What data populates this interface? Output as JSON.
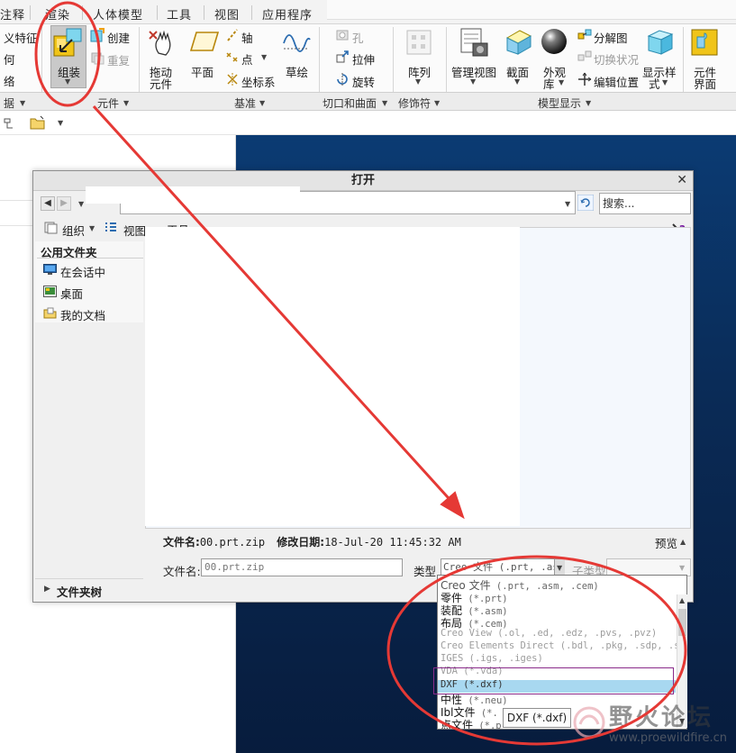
{
  "ribbon": {
    "tabs": [
      "注释",
      "渲染",
      "人体模型",
      "工具",
      "视图",
      "应用程序"
    ],
    "left_fragments": [
      "义特征",
      "何",
      "络"
    ],
    "assemble": "组装",
    "create": "创建",
    "repeat": "重复",
    "drag_component": [
      "拖动",
      "元件"
    ],
    "plane": "平面",
    "axis": "轴",
    "point": "点",
    "coord_sys": "坐标系",
    "sketch": "草绘",
    "hole": "孔",
    "extrude": "拉伸",
    "revolve": "旋转",
    "pattern": "阵列",
    "manage_views": "管理视图",
    "section": "截面",
    "appearance": [
      "外观",
      "库"
    ],
    "explode_view": "分解图",
    "toggle_state": "切换状况",
    "edit_position": "编辑位置",
    "display_style": [
      "显示样",
      "式"
    ],
    "component_interface": [
      "元件",
      "界面"
    ],
    "groups": {
      "data": "据",
      "component": "元件",
      "datum": "基准",
      "cut_surface": "切口和曲面",
      "modifier": "修饰符",
      "model_display": "模型显示"
    }
  },
  "dialog": {
    "title": "打开",
    "search_placeholder": "搜索...",
    "organize": "组织",
    "views": "视图",
    "tools": "工具",
    "public_folders": "公用文件夹",
    "folders": [
      "在会话中",
      "桌面",
      "我的文档"
    ],
    "folder_tree": "文件夹树",
    "info_label_name": "文件名:",
    "info_name": "00.prt.zip",
    "info_label_date": "修改日期:",
    "info_date": "18-Jul-20 11:45:32 AM",
    "preview": "预览",
    "filename_label": "文件名:",
    "filename_value": "00.prt.zip",
    "type_label": "类型",
    "type_value": "Creo 文件 (.prt, .as",
    "subtype_label": "子类型",
    "tooltip": "DXF (*.dxf)"
  },
  "type_options": [
    {
      "name": "Creo 文件",
      "ext": "(.prt, .asm, .cem)"
    },
    {
      "name": "零件",
      "ext": "(*.prt)"
    },
    {
      "name": "装配",
      "ext": "(*.asm)"
    },
    {
      "name": "布局",
      "ext": "(*.cem)"
    },
    {
      "name": "Creo View",
      "ext": "(.ol, .ed, .edz, .pvs, .pvz)"
    },
    {
      "name": "Creo Elements Direct",
      "ext": "(.bdl, .pkg, .sdp, .sd"
    },
    {
      "name": "IGES",
      "ext": "(.igs, .iges)"
    },
    {
      "name": "VDA",
      "ext": "(*.vda)"
    },
    {
      "name": "DXF",
      "ext": "(*.dxf)"
    },
    {
      "name": "中性",
      "ext": "(*.neu)"
    },
    {
      "name": "Ibl文件",
      "ext": "(*."
    },
    {
      "name": "点文件",
      "ext": "(*.p"
    }
  ],
  "watermark": {
    "text": "野火论坛",
    "url": "www.proewildfire.cn"
  },
  "colors": {
    "viewport": "#0b3b73",
    "annotation": "#e53935",
    "selected": "#a8d8f0"
  }
}
